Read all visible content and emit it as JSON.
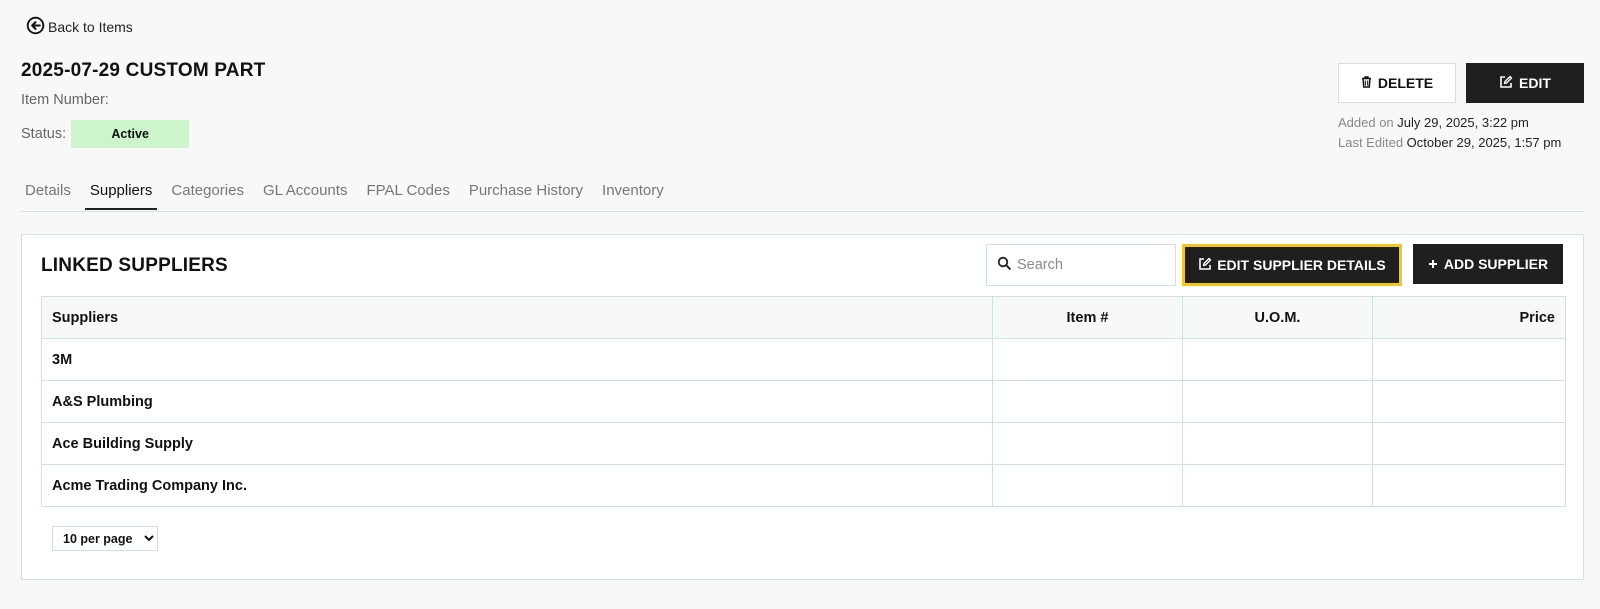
{
  "nav": {
    "back_label": "Back to Items"
  },
  "item": {
    "title": "2025-07-29 CUSTOM PART",
    "number_label": "Item Number:",
    "status_label": "Status:",
    "status_value": "Active"
  },
  "actions": {
    "delete_label": "DELETE",
    "edit_label": "EDIT"
  },
  "meta": {
    "added_label": "Added on",
    "added_value": "July 29, 2025, 3:22 pm",
    "edited_label": "Last Edited",
    "edited_value": "October 29, 2025, 1:57 pm"
  },
  "tabs": [
    {
      "label": "Details",
      "active": false
    },
    {
      "label": "Suppliers",
      "active": true
    },
    {
      "label": "Categories",
      "active": false
    },
    {
      "label": "GL Accounts",
      "active": false
    },
    {
      "label": "FPAL Codes",
      "active": false
    },
    {
      "label": "Purchase History",
      "active": false
    },
    {
      "label": "Inventory",
      "active": false
    }
  ],
  "suppliers_panel": {
    "title": "LINKED SUPPLIERS",
    "search_placeholder": "Search",
    "edit_details_label": "EDIT SUPPLIER DETAILS",
    "add_label": "ADD SUPPLIER",
    "highlight_color": "#f2c521",
    "columns": [
      "Suppliers",
      "Item #",
      "U.O.M.",
      "Price"
    ],
    "rows": [
      {
        "name": "3M",
        "item_no": "",
        "uom": "",
        "price": ""
      },
      {
        "name": "A&S Plumbing",
        "item_no": "",
        "uom": "",
        "price": ""
      },
      {
        "name": "Ace Building Supply",
        "item_no": "",
        "uom": "",
        "price": ""
      },
      {
        "name": "Acme Trading Company Inc.",
        "item_no": "",
        "uom": "",
        "price": ""
      }
    ],
    "per_page_value": "10 per page"
  },
  "icons": {
    "back": "arrow-circle-left-icon",
    "delete": "trash-icon",
    "edit": "pencil-square-icon",
    "search": "search-icon",
    "add": "plus-icon"
  }
}
